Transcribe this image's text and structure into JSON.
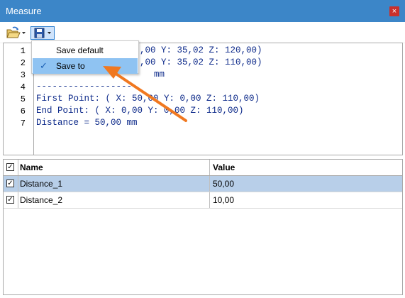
{
  "window": {
    "title": "Measure",
    "close_glyph": "×"
  },
  "toolbar": {
    "open_icon": "open-folder-icon",
    "save_icon": "save-disk-icon",
    "dropdown_glyph": "▾"
  },
  "menu": {
    "items": [
      {
        "label": "Save default",
        "checked": false
      },
      {
        "label": "Save to",
        "checked": true
      }
    ],
    "check_glyph": "✓"
  },
  "editor": {
    "line_numbers": [
      "1",
      "2",
      "3",
      "4",
      "5",
      "6",
      "7"
    ],
    "lines": [
      "( X: 50,00 Y: 35,02 Z: 120,00)",
      "( X: 50,00 Y: 35,02 Z: 110,00)",
      "Distance = 50,00 mm",
      "------------------",
      "First Point: ( X: 50,00 Y: 0,00 Z: 110,00)",
      "End Point: ( X: 0,00 Y: 0,00 Z: 110,00)",
      "Distance = 50,00 mm"
    ],
    "visible_partial": {
      "line1": ",00 Y: 35,02 Z: 120,00)",
      "line2": ",00 Y: 35,02 Z: 110,00)",
      "line3": "mm"
    }
  },
  "grid": {
    "header_check": true,
    "columns": [
      "Name",
      "Value"
    ],
    "rows": [
      {
        "checked": true,
        "name": "Distance_1",
        "value": "50,00",
        "selected": true
      },
      {
        "checked": true,
        "name": "Distance_2",
        "value": "10,00",
        "selected": false
      }
    ]
  },
  "colors": {
    "titlebar": "#3c86c8",
    "menu_selection": "#8fc3f2",
    "row_selection": "#b8cfe9",
    "code_text": "#0d2a8a",
    "arrow": "#f07820"
  }
}
